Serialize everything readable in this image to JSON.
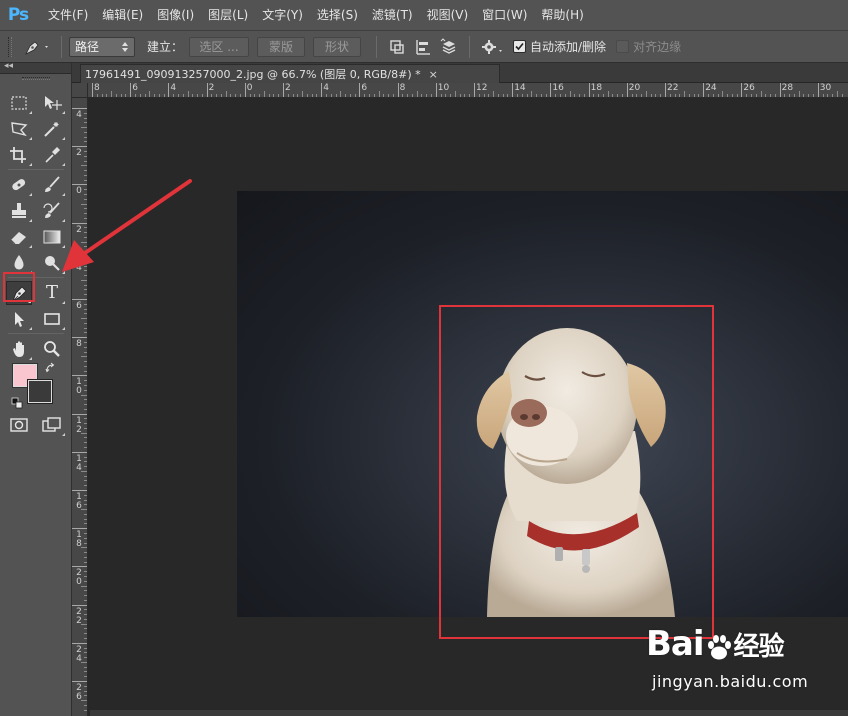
{
  "app": {
    "logo": "Ps"
  },
  "menu": [
    "文件(F)",
    "编辑(E)",
    "图像(I)",
    "图层(L)",
    "文字(Y)",
    "选择(S)",
    "滤镜(T)",
    "视图(V)",
    "窗口(W)",
    "帮助(H)"
  ],
  "options": {
    "tool_icon": "pen-tool-icon",
    "mode_value": "路径",
    "make_label": "建立：",
    "selection_button": "选区 ...",
    "mask_button": "蒙版",
    "shape_button": "形状",
    "auto_add_delete": {
      "label": "自动添加/删除",
      "checked": true
    },
    "align_edges": {
      "label": "对齐边缘",
      "checked": false
    }
  },
  "document": {
    "tab_title": "17961491_090913257000_2.jpg @ 66.7% (图层 0, RGB/8#) *",
    "close_label": "×"
  },
  "ruler": {
    "horizontal": [
      "8",
      "6",
      "4",
      "2",
      "0",
      "2",
      "4",
      "6",
      "8",
      "10",
      "12",
      "14",
      "16",
      "18",
      "20",
      "22",
      "24",
      "26",
      "28",
      "30"
    ],
    "vertical": [
      "4",
      "2",
      "0",
      "2",
      "4",
      "6",
      "8",
      "10",
      "12",
      "14",
      "16",
      "18",
      "20",
      "22",
      "24",
      "26"
    ]
  },
  "toolbar": {
    "collapse_label": "◂◂",
    "tools": [
      "rectangular-marquee-icon",
      "move-icon",
      "lasso-icon",
      "magic-wand-icon",
      "crop-icon",
      "eyedropper-icon",
      "spot-healing-icon",
      "brush-icon",
      "clone-stamp-icon",
      "history-brush-icon",
      "eraser-icon",
      "gradient-icon",
      "blur-icon",
      "dodge-icon",
      "pen-tool-icon",
      "type-tool-icon",
      "path-selection-icon",
      "rectangle-shape-icon",
      "hand-icon",
      "zoom-icon",
      "quick-mask-icon",
      "screen-mode-icon"
    ],
    "type_tool_glyph": "T",
    "foreground_color": "#f9c5ce",
    "background_color": "#3a3a3a"
  },
  "accent": {
    "highlight": "#e0343a"
  },
  "watermark": {
    "brand": "Bai",
    "brand_cn": "经验",
    "url": "jingyan.baidu.com"
  }
}
